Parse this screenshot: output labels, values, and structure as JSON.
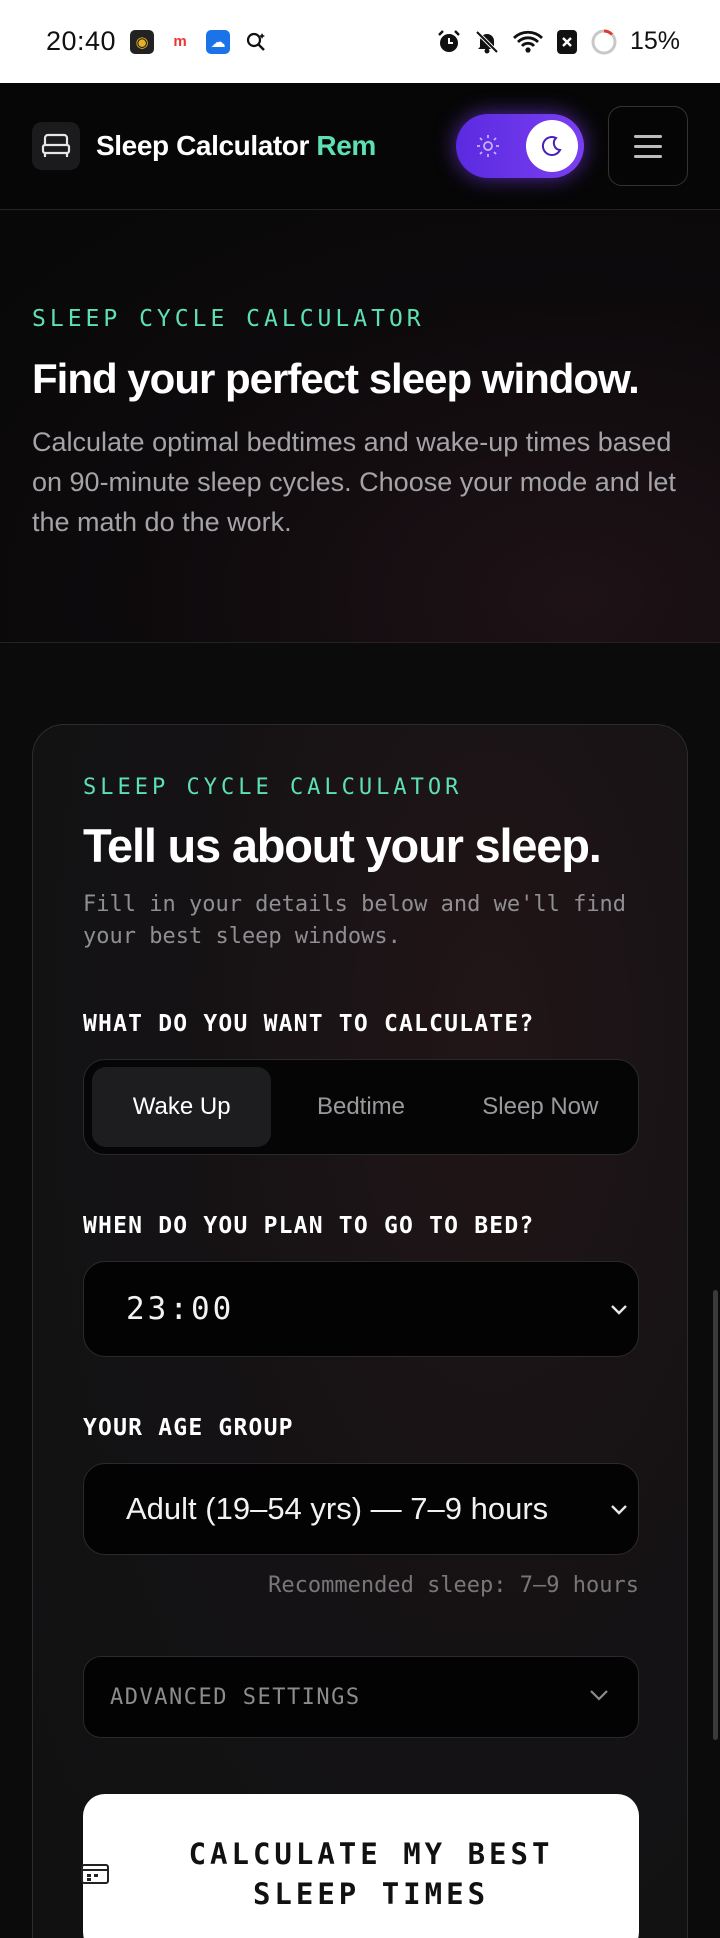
{
  "status_bar": {
    "time": "20:40",
    "battery": "15%",
    "icons": [
      "app-icon",
      "m-app-icon",
      "cloud-app-icon",
      "search-ai-icon",
      "alarm-icon",
      "bell-off-icon",
      "wifi-icon",
      "sim-off-icon",
      "battery-icon"
    ]
  },
  "header": {
    "brand_main": "Sleep Calculator",
    "brand_accent": "Rem",
    "theme_toggle": {
      "state": "dark"
    }
  },
  "hero": {
    "eyebrow": "SLEEP CYCLE CALCULATOR",
    "title": "Find your perfect sleep window.",
    "description": "Calculate optimal bedtimes and wake-up times based on 90-minute sleep cycles. Choose your mode and let the math do the work."
  },
  "card": {
    "eyebrow": "SLEEP CYCLE CALCULATOR",
    "title": "Tell us about your sleep.",
    "description": "Fill in your details below and we'll find your best sleep windows.",
    "mode_label": "WHAT DO YOU WANT TO CALCULATE?",
    "modes": [
      "Wake Up",
      "Bedtime",
      "Sleep Now"
    ],
    "selected_mode": "Wake Up",
    "bed_label": "WHEN DO YOU PLAN TO GO TO BED?",
    "bed_time": "23:00",
    "age_label": "YOUR AGE GROUP",
    "age_value": "Adult (19–54 yrs) — 7–9 hours",
    "recommended": "Recommended sleep: 7–9 hours",
    "advanced_label": "ADVANCED SETTINGS",
    "cta_label": "CALCULATE MY BEST SLEEP TIMES"
  },
  "colors": {
    "accent": "#5ee0b7",
    "toggle": "#6a35ea",
    "background": "#0b0b0c"
  }
}
